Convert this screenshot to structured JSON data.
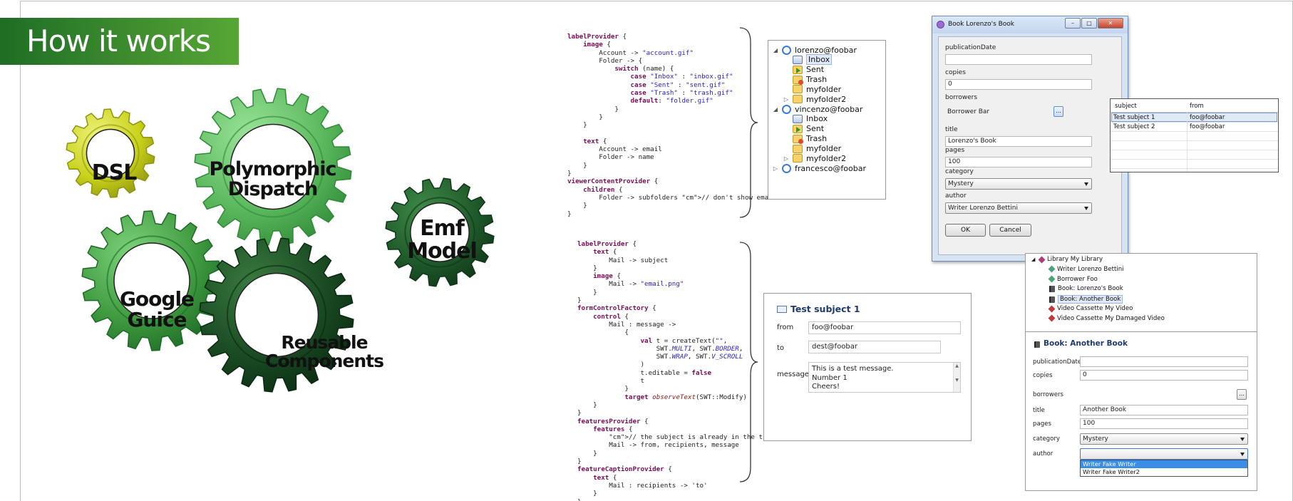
{
  "banner": {
    "title": "How it works"
  },
  "gears": {
    "dsl": "DSL",
    "polymorphic_line1": "Polymorphic",
    "polymorphic_line2": "Dispatch",
    "emf_line1": "Emf",
    "emf_line2": "Model",
    "guice_line1": "Google",
    "guice_line2": "Guice",
    "reusable_line1": "Reusable",
    "reusable_line2": "Components"
  },
  "code_top": [
    "labelProvider {",
    "    image {",
    "        Account -> \"account.gif\"",
    "        Folder -> {",
    "            switch (name) {",
    "                case \"Inbox\" : \"inbox.gif\"",
    "                case \"Sent\" : \"sent.gif\"",
    "                case \"Trash\" : \"trash.gif\"",
    "                default: \"folder.gif\"",
    "            }",
    "        }",
    "    }",
    "",
    "    text {",
    "        Account -> email",
    "        Folder -> name",
    "    }",
    "}",
    "viewerContentProvider {",
    "    children {",
    "        Folder -> subfolders // don't show emails",
    "    }",
    "}"
  ],
  "code_bottom": [
    "labelProvider {",
    "    text {",
    "        Mail -> subject",
    "    }",
    "    image {",
    "        Mail -> \"email.png\"",
    "    }",
    "}",
    "formControlFactory {",
    "    control {",
    "        Mail : message ->",
    "            {",
    "                val t = createText(\"\",",
    "                    SWT.MULTI, SWT.BORDER,",
    "                    SWT.WRAP, SWT.V_SCROLL",
    "                )",
    "                t.editable = false",
    "                t",
    "            }",
    "            target observeText(SWT::Modify)",
    "    }",
    "}",
    "featuresProvider {",
    "    features {",
    "        // the subject is already in the title",
    "        Mail -> from, recipients, message",
    "    }",
    "}",
    "featureCaptionProvider {",
    "    text {",
    "        Mail : recipients -> 'to'",
    "    }",
    "}"
  ],
  "mail_tree": [
    {
      "label": "lorenzo@foobar",
      "icon": "account",
      "twisty": "◢",
      "indent": 0
    },
    {
      "label": "Inbox",
      "icon": "inbox",
      "twisty": "",
      "indent": 1,
      "selected": true
    },
    {
      "label": "Sent",
      "icon": "sent",
      "twisty": "",
      "indent": 1
    },
    {
      "label": "Trash",
      "icon": "trash",
      "twisty": "",
      "indent": 1
    },
    {
      "label": "myfolder",
      "icon": "folder",
      "twisty": "",
      "indent": 1
    },
    {
      "label": "myfolder2",
      "icon": "folder",
      "twisty": "▷",
      "indent": 1
    },
    {
      "label": "vincenzo@foobar",
      "icon": "account",
      "twisty": "◢",
      "indent": 0
    },
    {
      "label": "Inbox",
      "icon": "inbox",
      "twisty": "",
      "indent": 1
    },
    {
      "label": "Sent",
      "icon": "sent",
      "twisty": "",
      "indent": 1
    },
    {
      "label": "Trash",
      "icon": "trash",
      "twisty": "",
      "indent": 1
    },
    {
      "label": "myfolder",
      "icon": "folder",
      "twisty": "",
      "indent": 1
    },
    {
      "label": "myfolder2",
      "icon": "folder",
      "twisty": "▷",
      "indent": 1
    },
    {
      "label": "francesco@foobar",
      "icon": "account",
      "twisty": "▷",
      "indent": 0
    }
  ],
  "mail_form": {
    "title": "Test subject 1",
    "from_label": "from",
    "from_value": "foo@foobar",
    "to_label": "to",
    "to_value": "dest@foobar",
    "message_label": "message",
    "message_value": "This is a test message.\nNumber 1\nCheers!"
  },
  "book_dialog": {
    "title": "Book Lorenzo's Book",
    "publicationDate_label": "publicationDate",
    "publicationDate_value": "",
    "copies_label": "copies",
    "copies_value": "0",
    "borrowers_label": "borrowers",
    "borrowers_value": "Borrower Bar",
    "title_label": "title",
    "title_value": "Lorenzo's Book",
    "pages_label": "pages",
    "pages_value": "100",
    "category_label": "category",
    "category_value": "Mystery",
    "author_label": "author",
    "author_value": "Writer Lorenzo Bettini",
    "ok": "OK",
    "cancel": "Cancel",
    "dots": "..."
  },
  "borrow_table": {
    "headers": [
      "subject",
      "from"
    ],
    "rows": [
      [
        "Test subject 1",
        "foo@foobar"
      ],
      [
        "Test subject 2",
        "foo@foobar"
      ]
    ]
  },
  "library_tree": [
    {
      "label": "Library My Library",
      "icon": "gem",
      "color": "#b03a7a",
      "indent": 0,
      "twisty": "◢"
    },
    {
      "label": "Writer Lorenzo Bettini",
      "icon": "gem",
      "color": "#4aa37a",
      "indent": 1,
      "twisty": ""
    },
    {
      "label": "Borrower Foo",
      "icon": "gem",
      "color": "#4aa37a",
      "indent": 1,
      "twisty": ""
    },
    {
      "label": "Book: Lorenzo's Book",
      "icon": "book",
      "color": "#444444",
      "indent": 1,
      "twisty": ""
    },
    {
      "label": "Book: Another Book",
      "icon": "book",
      "color": "#444444",
      "indent": 1,
      "twisty": "",
      "selected": true
    },
    {
      "label": "Video Cassette My Video",
      "icon": "gem",
      "color": "#c03a3a",
      "indent": 1,
      "twisty": ""
    },
    {
      "label": "Video Cassette My Damaged Video",
      "icon": "gem",
      "color": "#c03a3a",
      "indent": 1,
      "twisty": ""
    }
  ],
  "book_form": {
    "title": "Book: Another Book",
    "publicationDate_label": "publicationDate",
    "copies_label": "copies",
    "copies_value": "0",
    "borrowers_label": "borrowers",
    "title_label": "title",
    "title_value": "Another Book",
    "pages_label": "pages",
    "pages_value": "100",
    "category_label": "category",
    "category_value": "Mystery",
    "author_label": "author",
    "author_options": [
      "Writer Fake Writer",
      "Writer Fake Writer2"
    ],
    "dots": "..."
  },
  "colors": {
    "banner": "#2e7d2f",
    "gear_yellow": "#c9d21a",
    "gear_light_green": "#5ab85c",
    "gear_dark_green": "#1f5a2a",
    "gear_mid_green": "#3f9a3f"
  }
}
